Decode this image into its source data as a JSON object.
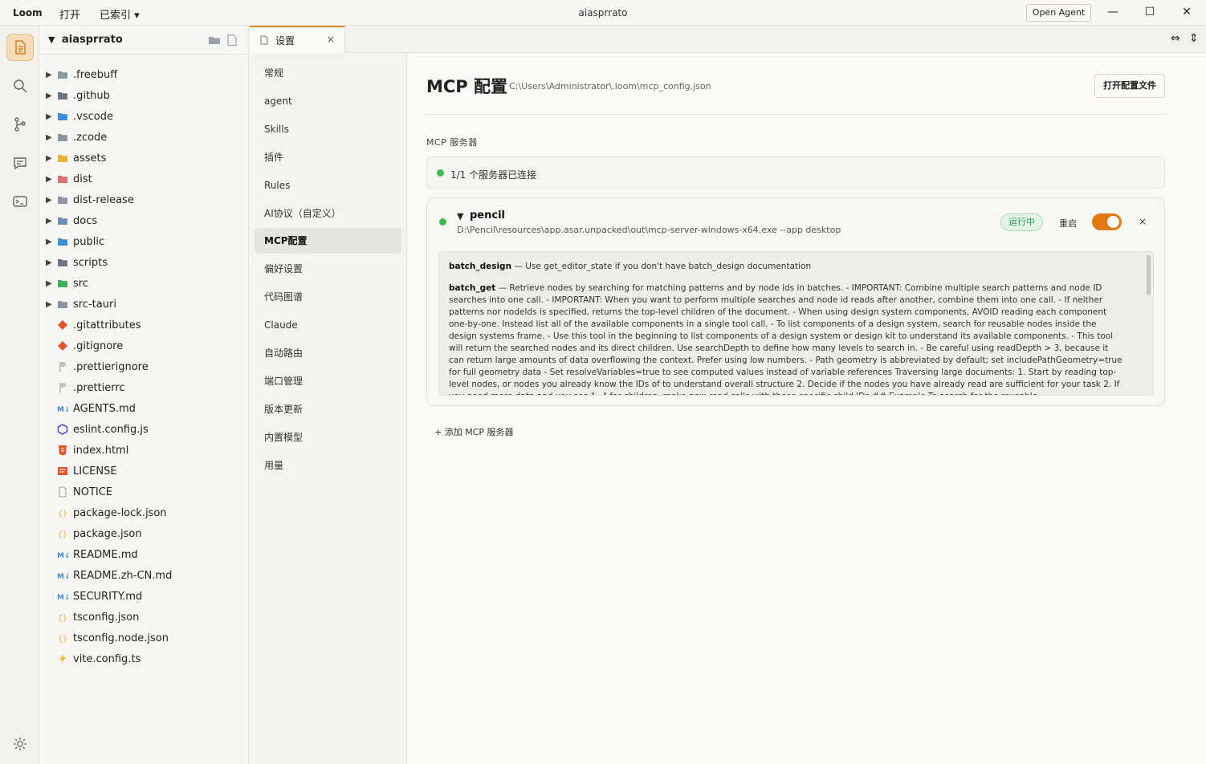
{
  "titlebar": {
    "brand": "Loom",
    "menu_open": "打开",
    "menu_indexed": "已索引 ▾",
    "window_title": "aiasprrato",
    "open_agent": "Open Agent",
    "minimize": "—",
    "maximize": "☐",
    "close": "✕"
  },
  "activity": {
    "items": [
      "files-icon",
      "search-icon",
      "source-control-icon",
      "chat-icon",
      "terminal-icon"
    ],
    "accent": "#e08a2a"
  },
  "explorer": {
    "root": "aiasprrato",
    "folders": [
      ".freebuff",
      ".github",
      ".vscode",
      ".zcode",
      "assets",
      "dist",
      "dist-release",
      "docs",
      "public",
      "scripts",
      "src",
      "src-tauri"
    ],
    "files": [
      ".gitattributes",
      ".gitignore",
      ".prettierignore",
      ".prettierrc",
      "AGENTS.md",
      "eslint.config.js",
      "index.html",
      "LICENSE",
      "NOTICE",
      "package-lock.json",
      "package.json",
      "README.md",
      "README.zh-CN.md",
      "SECURITY.md",
      "tsconfig.json",
      "tsconfig.node.json",
      "vite.config.ts"
    ]
  },
  "tab": {
    "label": "设置",
    "close": "×",
    "right_icons": [
      "⇔",
      "⇕"
    ]
  },
  "settings_nav": {
    "items": [
      "常规",
      "agent",
      "Skills",
      "插件",
      "Rules",
      "AI协议（自定义）",
      "MCP配置",
      "偏好设置",
      "代码图谱",
      "Claude",
      "自动路由",
      "端口管理",
      "版本更新",
      "内置模型",
      "用量"
    ],
    "active": "MCP配置"
  },
  "main": {
    "title": "MCP 配置",
    "config_path": "C:\\Users\\Administrator\\.loom\\mcp_config.json",
    "open_config_button": "打开配置文件",
    "section_label": "MCP 服务器",
    "status_text": "1/1 个服务器已连接",
    "add_server": "+ 添加 MCP 服务器"
  },
  "server": {
    "name": "pencil",
    "command": "D:\\Pencil\\resources\\app.asar.unpacked\\out\\mcp-server-windows-x64.exe --app desktop",
    "status_badge": "运行中",
    "restart": "重启",
    "enabled": true,
    "close": "×",
    "status_color": "#3fb950",
    "toggle_color": "#e07a10",
    "tools": [
      {
        "name": "batch_design",
        "description": " — Use get_editor_state if you don't have batch_design documentation"
      },
      {
        "name": "batch_get",
        "description": " — Retrieve nodes by searching for matching patterns and by node ids in batches. - IMPORTANT: Combine multiple search patterns and node ID searches into one call. - IMPORTANT: When you want to perform multiple searches and node id reads after another, combine them into one call. - If neither patterns nor nodeIds is specified, returns the top-level children of the document. - When using design system components, AVOID reading each component one-by-one. Instead list all of the available components in a single tool call. - To list components of a design system, search for reusable nodes inside the design systems frame. - Use this tool in the beginning to list components of a design system or design kit to understand its available components. - This tool will return the searched nodes and its direct children. Use searchDepth to define how many levels to search in. - Be careful using readDepth > 3, because it can return large amounts of data overflowing the context. Prefer using low numbers. - Path geometry is abbreviated by default; set includePathGeometry=true for full geometry data - Set resolveVariables=true to see computed values instead of variable references Traversing large documents: 1. Start by reading top-level nodes, or nodes you already know the IDs of to understand overall structure 2. Decide if the nodes you have already read are sufficient for your task 2. If you need more data and you see \"...\" for children, make new read calls with those specific child IDs ## Example To search for the reusable"
      }
    ]
  }
}
